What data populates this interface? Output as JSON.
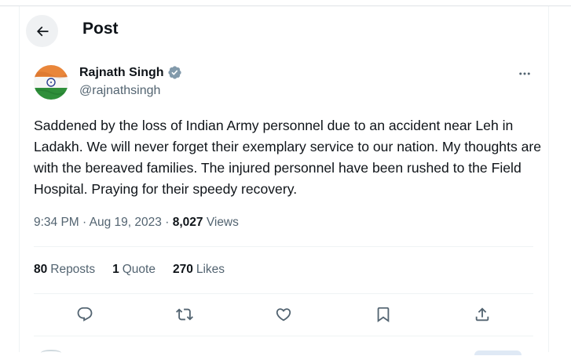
{
  "header": {
    "title": "Post",
    "back_icon": "arrow-left-icon"
  },
  "tweet": {
    "author_name": "Rajnath Singh",
    "handle": "@rajnathsingh",
    "verified": true,
    "text": "Saddened by the loss of Indian Army personnel due to an accident near Leh in Ladakh. We will never forget their exemplary service to our nation. My thoughts are with the bereaved families. The injured personnel have been rushed to the Field Hospital. Praying for their speedy recovery.",
    "time": "9:34 PM",
    "separator": "·",
    "date": "Aug 19, 2023",
    "views_count": "8,027",
    "views_label": "Views"
  },
  "stats": {
    "reposts_count": "80",
    "reposts_label": "Reposts",
    "quotes_count": "1",
    "quotes_label": "Quote",
    "likes_count": "270",
    "likes_label": "Likes"
  },
  "actions": [
    "reply-icon",
    "repost-icon",
    "like-icon",
    "bookmark-icon",
    "share-icon"
  ],
  "colors": {
    "text": "#0f1419",
    "secondary": "#536471",
    "verified_badge": "#829aab",
    "divider": "#eff3f4"
  }
}
